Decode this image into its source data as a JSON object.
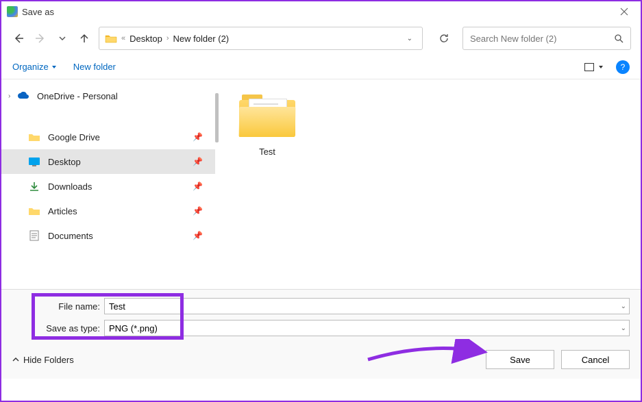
{
  "window": {
    "title": "Save as"
  },
  "nav": {
    "breadcrumb": [
      "Desktop",
      "New folder (2)"
    ],
    "search_placeholder": "Search New folder (2)"
  },
  "toolbar": {
    "organize": "Organize",
    "new_folder": "New folder"
  },
  "sidebar": {
    "root": {
      "label": "OneDrive - Personal"
    },
    "items": [
      {
        "label": "Google Drive"
      },
      {
        "label": "Desktop"
      },
      {
        "label": "Downloads"
      },
      {
        "label": "Articles"
      },
      {
        "label": "Documents"
      }
    ],
    "selected_index": 1
  },
  "content": {
    "tiles": [
      {
        "label": "Test"
      }
    ]
  },
  "form": {
    "filename_label": "File name:",
    "filename_value": "Test",
    "type_label": "Save as type:",
    "type_value": "PNG (*.png)"
  },
  "footer": {
    "hide_folders": "Hide Folders",
    "save": "Save",
    "cancel": "Cancel"
  }
}
